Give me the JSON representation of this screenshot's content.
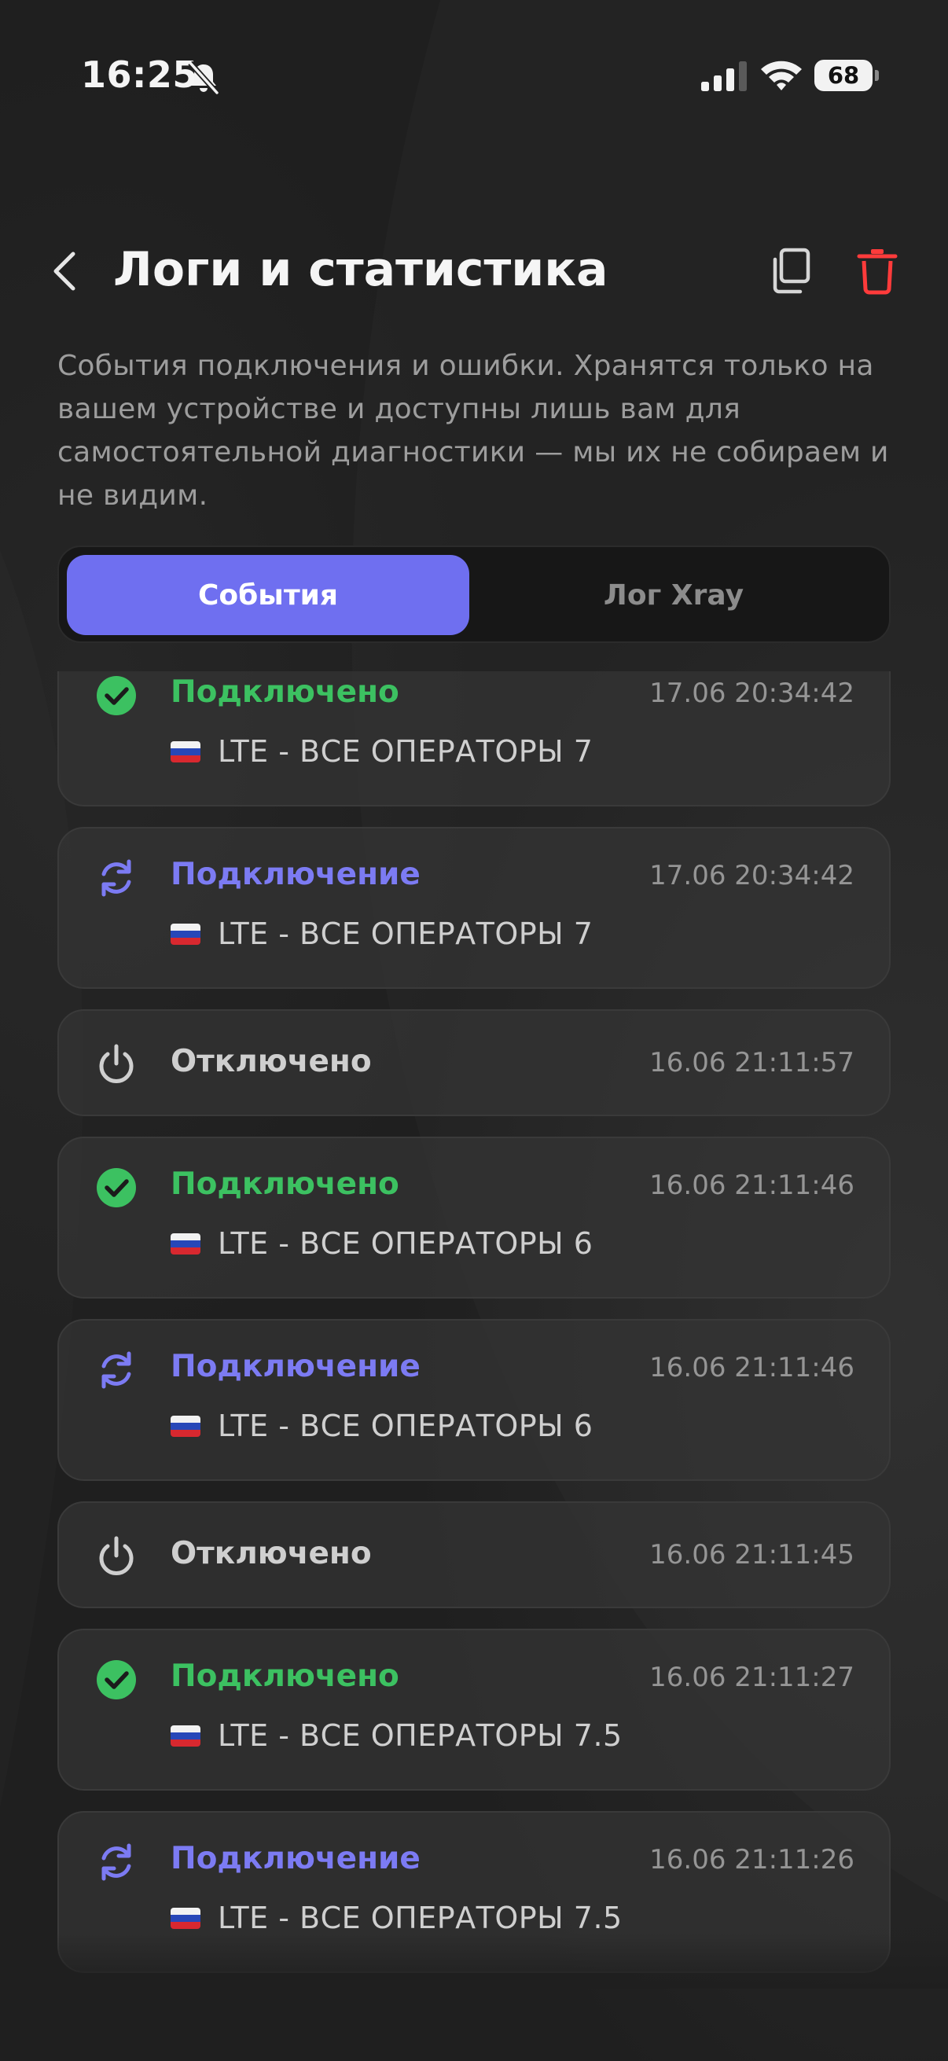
{
  "status_bar": {
    "time": "16:25",
    "battery": "68",
    "icons": [
      "bell-slash-icon",
      "cellular-signal-icon",
      "wifi-icon",
      "battery-icon"
    ]
  },
  "header": {
    "title": "Логи и статистика",
    "back_icon": "chevron-left-icon",
    "copy_icon": "copy-icon",
    "delete_icon": "trash-icon"
  },
  "description": "События подключения и ошибки. Хранятся только на вашем устройстве и доступны лишь вам для самостоятельной диагностики — мы их не собираем и не видим.",
  "tabs": [
    {
      "label": "События",
      "active": true
    },
    {
      "label": "Лог Xray",
      "active": false
    }
  ],
  "colors": {
    "accent": "#6f6ff0",
    "connected": "#3cc161",
    "connecting": "#7c7bf3",
    "delete": "#ff3b3b"
  },
  "events": [
    {
      "status": "Подключено",
      "type": "connected",
      "time": "17.06 20:34:42",
      "server": "LTE - ВСЕ ОПЕРАТОРЫ 7",
      "flag": "ru"
    },
    {
      "status": "Подключение",
      "type": "connecting",
      "time": "17.06 20:34:42",
      "server": "LTE - ВСЕ ОПЕРАТОРЫ 7",
      "flag": "ru"
    },
    {
      "status": "Отключено",
      "type": "disconnected",
      "time": "16.06 21:11:57"
    },
    {
      "status": "Подключено",
      "type": "connected",
      "time": "16.06 21:11:46",
      "server": "LTE - ВСЕ ОПЕРАТОРЫ 6",
      "flag": "ru"
    },
    {
      "status": "Подключение",
      "type": "connecting",
      "time": "16.06 21:11:46",
      "server": "LTE - ВСЕ ОПЕРАТОРЫ 6",
      "flag": "ru"
    },
    {
      "status": "Отключено",
      "type": "disconnected",
      "time": "16.06 21:11:45"
    },
    {
      "status": "Подключено",
      "type": "connected",
      "time": "16.06 21:11:27",
      "server": "LTE - ВСЕ ОПЕРАТОРЫ 7.5",
      "flag": "ru"
    },
    {
      "status": "Подключение",
      "type": "connecting",
      "time": "16.06 21:11:26",
      "server": "LTE - ВСЕ ОПЕРАТОРЫ 7.5",
      "flag": "ru"
    }
  ]
}
